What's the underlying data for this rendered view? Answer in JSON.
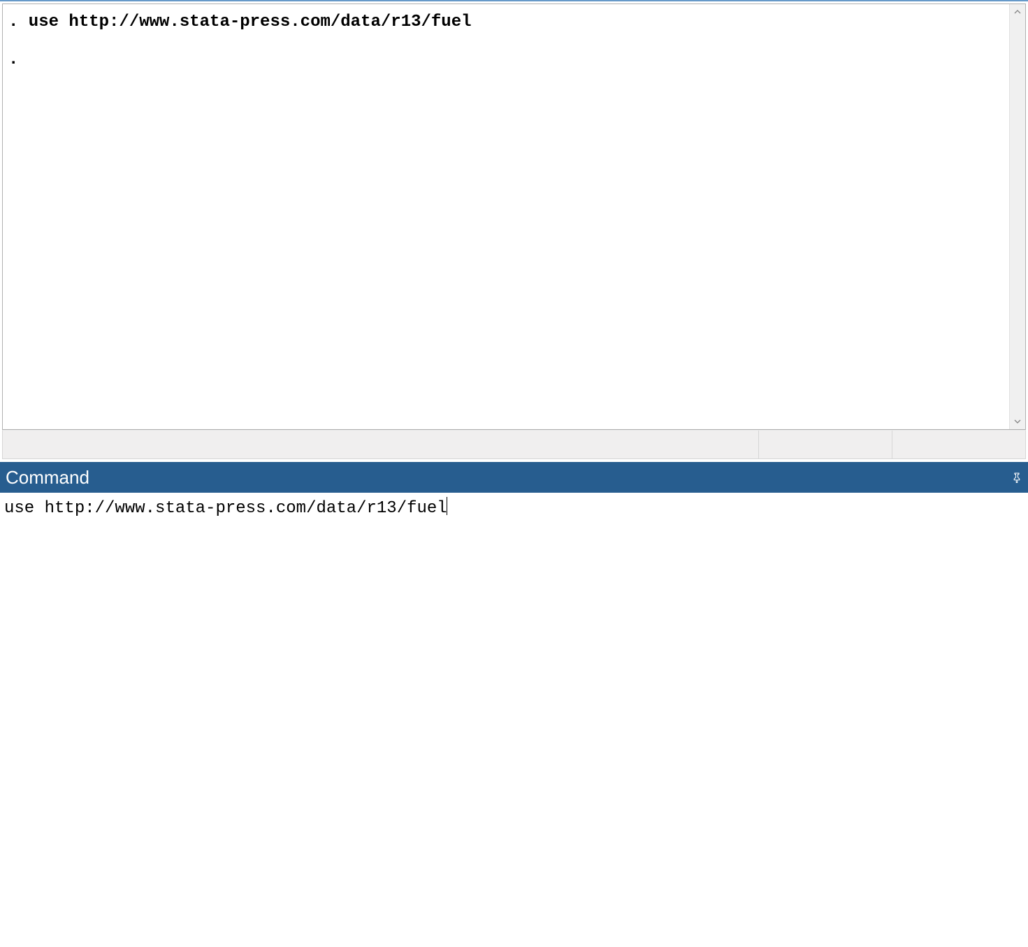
{
  "results": {
    "lines": [
      ". use http://www.stata-press.com/data/r13/fuel",
      "",
      "."
    ]
  },
  "command_panel": {
    "title": "Command",
    "input_value": "use http://www.stata-press.com/data/r13/fuel"
  },
  "icons": {
    "scroll_up": "chevron-up-icon",
    "scroll_down": "chevron-down-icon",
    "pin": "pin-icon"
  }
}
